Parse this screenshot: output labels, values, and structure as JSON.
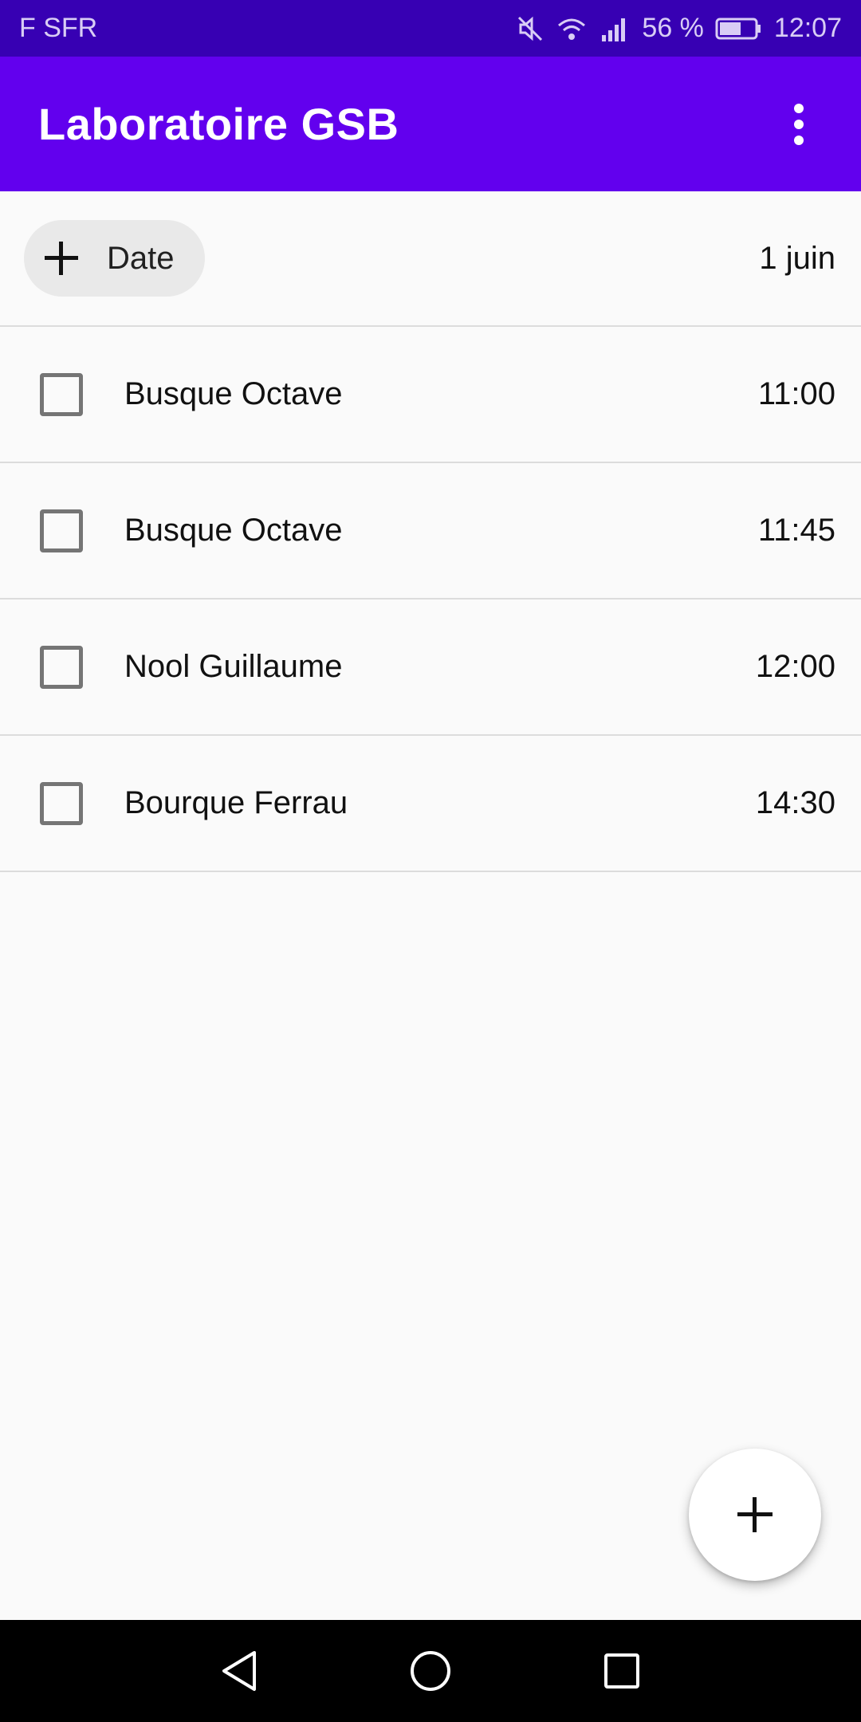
{
  "status_bar": {
    "carrier": "F SFR",
    "battery": "56 %",
    "time": "12:07",
    "icons": [
      "mute-icon",
      "wifi-icon",
      "signal-icon",
      "battery-icon"
    ]
  },
  "app_bar": {
    "title": "Laboratoire GSB",
    "overflow_icon": "more-vert-icon"
  },
  "filter": {
    "chip_label": "Date",
    "chip_icon": "plus-icon",
    "selected_date": "1 juin"
  },
  "appointments": [
    {
      "name": "Busque Octave",
      "time": "11:00",
      "checked": false
    },
    {
      "name": "Busque Octave",
      "time": "11:45",
      "checked": false
    },
    {
      "name": "Nool Guillaume",
      "time": "12:00",
      "checked": false
    },
    {
      "name": "Bourque Ferrau",
      "time": "14:30",
      "checked": false
    }
  ],
  "fab": {
    "icon": "plus-icon"
  },
  "nav_bar": {
    "icons": [
      "back-icon",
      "home-icon",
      "recents-icon"
    ]
  },
  "colors": {
    "status_bar": "#3700b3",
    "app_bar": "#6200ee",
    "background": "#fafafa",
    "chip": "#e9e9e9",
    "checkbox_border": "#757575",
    "divider": "#dcdcdc"
  }
}
